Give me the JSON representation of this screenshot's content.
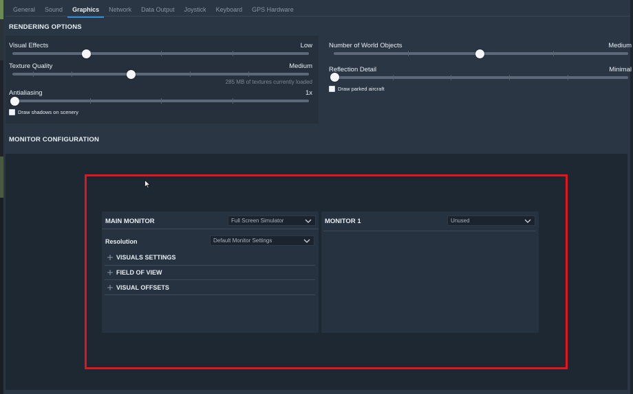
{
  "tabs": [
    {
      "label": "General",
      "active": false
    },
    {
      "label": "Sound",
      "active": false
    },
    {
      "label": "Graphics",
      "active": true
    },
    {
      "label": "Network",
      "active": false
    },
    {
      "label": "Data Output",
      "active": false
    },
    {
      "label": "Joystick",
      "active": false
    },
    {
      "label": "Keyboard",
      "active": false
    },
    {
      "label": "GPS Hardware",
      "active": false
    }
  ],
  "rendering": {
    "title": "RENDERING OPTIONS",
    "visual_effects": {
      "label": "Visual Effects",
      "value": "Low",
      "level": 0.25
    },
    "texture_quality": {
      "label": "Texture Quality",
      "value": "Medium",
      "level": 0.4,
      "note": "285 MB of textures currently loaded"
    },
    "antialiasing": {
      "label": "Antialiasing",
      "value": "1x",
      "level": 0.0
    },
    "world_objects": {
      "label": "Number of World Objects",
      "value": "Medium",
      "level": 0.5
    },
    "reflection_detail": {
      "label": "Reflection Detail",
      "value": "Minimal",
      "level": 0.0
    },
    "draw_shadows": {
      "label": "Draw shadows on scenery",
      "checked": false
    },
    "draw_parked": {
      "label": "Draw parked aircraft",
      "checked": false
    }
  },
  "monitor": {
    "title": "MONITOR CONFIGURATION",
    "main": {
      "title": "MAIN MONITOR",
      "mode": "Full Screen Simulator",
      "resolution_label": "Resolution",
      "resolution_value": "Default Monitor Settings",
      "sections": [
        "VISUALS SETTINGS",
        "FIELD OF VIEW",
        "VISUAL OFFSETS"
      ]
    },
    "monitor1": {
      "title": "MONITOR 1",
      "mode": "Unused"
    }
  },
  "colors": {
    "accent": "#2f8fd8",
    "highlight": "#e3141b",
    "background": "#2a3644"
  },
  "icons": [
    "chevron-down-icon",
    "plus-icon",
    "mouse-pointer-icon",
    "checkbox-icon"
  ]
}
